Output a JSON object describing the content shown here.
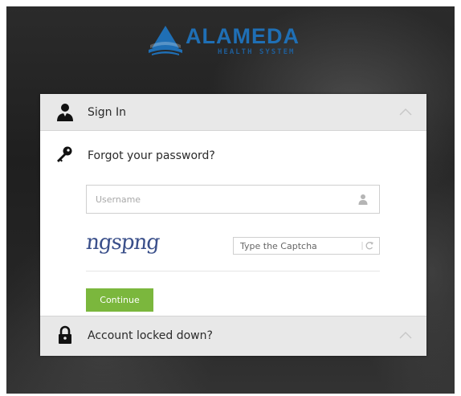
{
  "brand": {
    "name": "ALAMEDA",
    "subtitle": "HEALTH SYSTEM",
    "color": "#1f6fb5"
  },
  "sign_in": {
    "label": "Sign In",
    "icon": "user-silhouette-icon"
  },
  "forgot": {
    "label": "Forgot your password?",
    "icon": "key-icon"
  },
  "username": {
    "placeholder": "Username",
    "value": "",
    "icon": "user-icon"
  },
  "captcha": {
    "image_text": "ngspng",
    "placeholder": "Type the Captcha",
    "value": "",
    "refresh_icon": "refresh-icon"
  },
  "continue_button": {
    "label": "Continue",
    "color": "#7bb73d"
  },
  "locked": {
    "label": "Account locked down?",
    "icon": "padlock-icon"
  }
}
